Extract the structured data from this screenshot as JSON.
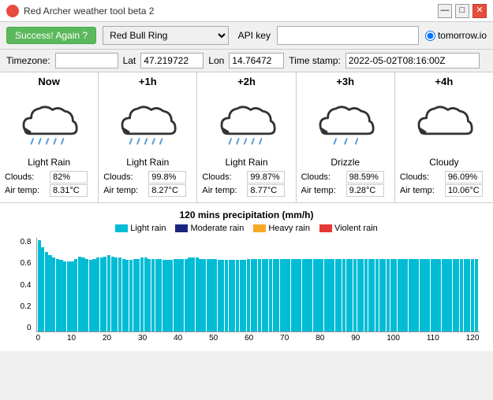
{
  "titleBar": {
    "title": "Red Archer weather tool beta 2",
    "controls": [
      "—",
      "□",
      "✕"
    ]
  },
  "toolbar": {
    "successBtn": "Success! Again ?",
    "locationDropdown": "Red Bull Ring",
    "apiKeyLabel": "API key",
    "apiKeyPlaceholder": "",
    "radioProvider": "tomorrow.io"
  },
  "params": {
    "timezoneLabel": "Timezone:",
    "timezonePlaceholder": "",
    "latLabel": "Lat",
    "latValue": "47.219722",
    "lonLabel": "Lon",
    "lonValue": "14.76472",
    "timestampLabel": "Time stamp:",
    "timestampValue": "2022-05-02T08:16:00Z"
  },
  "weatherColumns": [
    {
      "header": "Now",
      "icon": "rain",
      "label": "Light Rain",
      "clouds": "82%",
      "airTemp": "8.31°C"
    },
    {
      "header": "+1h",
      "icon": "rain",
      "label": "Light Rain",
      "clouds": "99.8%",
      "airTemp": "8.27°C"
    },
    {
      "header": "+2h",
      "icon": "rain",
      "label": "Light Rain",
      "clouds": "99.87%",
      "airTemp": "8.77°C"
    },
    {
      "header": "+3h",
      "icon": "drizzle",
      "label": "Drizzle",
      "clouds": "98.59%",
      "airTemp": "9.28°C"
    },
    {
      "header": "+4h",
      "icon": "cloudy",
      "label": "Cloudy",
      "clouds": "96.09%",
      "airTemp": "10.06°C"
    }
  ],
  "chart": {
    "title": "120 mins precipitation (mm/h)",
    "legend": [
      {
        "label": "Light rain",
        "color": "#00bcd4"
      },
      {
        "label": "Moderate rain",
        "color": "#1a237e"
      },
      {
        "label": "Heavy rain",
        "color": "#f9a825"
      },
      {
        "label": "Violent rain",
        "color": "#e53935"
      }
    ],
    "yAxis": [
      "0.8",
      "0.6",
      "0.4",
      "0.2",
      "0"
    ],
    "xLabels": [
      "0",
      "10",
      "20",
      "30",
      "40",
      "50",
      "60",
      "70",
      "80",
      "90",
      "100",
      "110",
      "120"
    ],
    "bars": [
      0.78,
      0.72,
      0.68,
      0.65,
      0.63,
      0.62,
      0.61,
      0.6,
      0.6,
      0.6,
      0.62,
      0.64,
      0.63,
      0.62,
      0.61,
      0.62,
      0.63,
      0.63,
      0.64,
      0.65,
      0.64,
      0.63,
      0.63,
      0.62,
      0.61,
      0.61,
      0.62,
      0.62,
      0.63,
      0.63,
      0.62,
      0.62,
      0.62,
      0.62,
      0.61,
      0.61,
      0.61,
      0.62,
      0.62,
      0.62,
      0.62,
      0.63,
      0.63,
      0.63,
      0.62,
      0.62,
      0.62,
      0.62,
      0.62,
      0.61,
      0.61,
      0.61,
      0.61,
      0.61,
      0.61,
      0.61,
      0.61,
      0.62,
      0.62,
      0.62,
      0.62,
      0.62,
      0.62,
      0.62,
      0.62,
      0.62,
      0.62,
      0.62,
      0.62,
      0.62,
      0.62,
      0.62,
      0.62,
      0.62,
      0.62,
      0.62,
      0.62,
      0.62,
      0.62,
      0.62,
      0.62,
      0.62,
      0.62,
      0.62,
      0.62,
      0.62,
      0.62,
      0.62,
      0.62,
      0.62,
      0.62,
      0.62,
      0.62,
      0.62,
      0.62,
      0.62,
      0.62,
      0.62,
      0.62,
      0.62,
      0.62,
      0.62,
      0.62,
      0.62,
      0.62,
      0.62,
      0.62,
      0.62,
      0.62,
      0.62,
      0.62,
      0.62,
      0.62,
      0.62,
      0.62,
      0.62,
      0.62,
      0.62,
      0.62,
      0.62
    ]
  },
  "labels": {
    "clouds": "Clouds:",
    "airTemp": "Air temp:"
  }
}
